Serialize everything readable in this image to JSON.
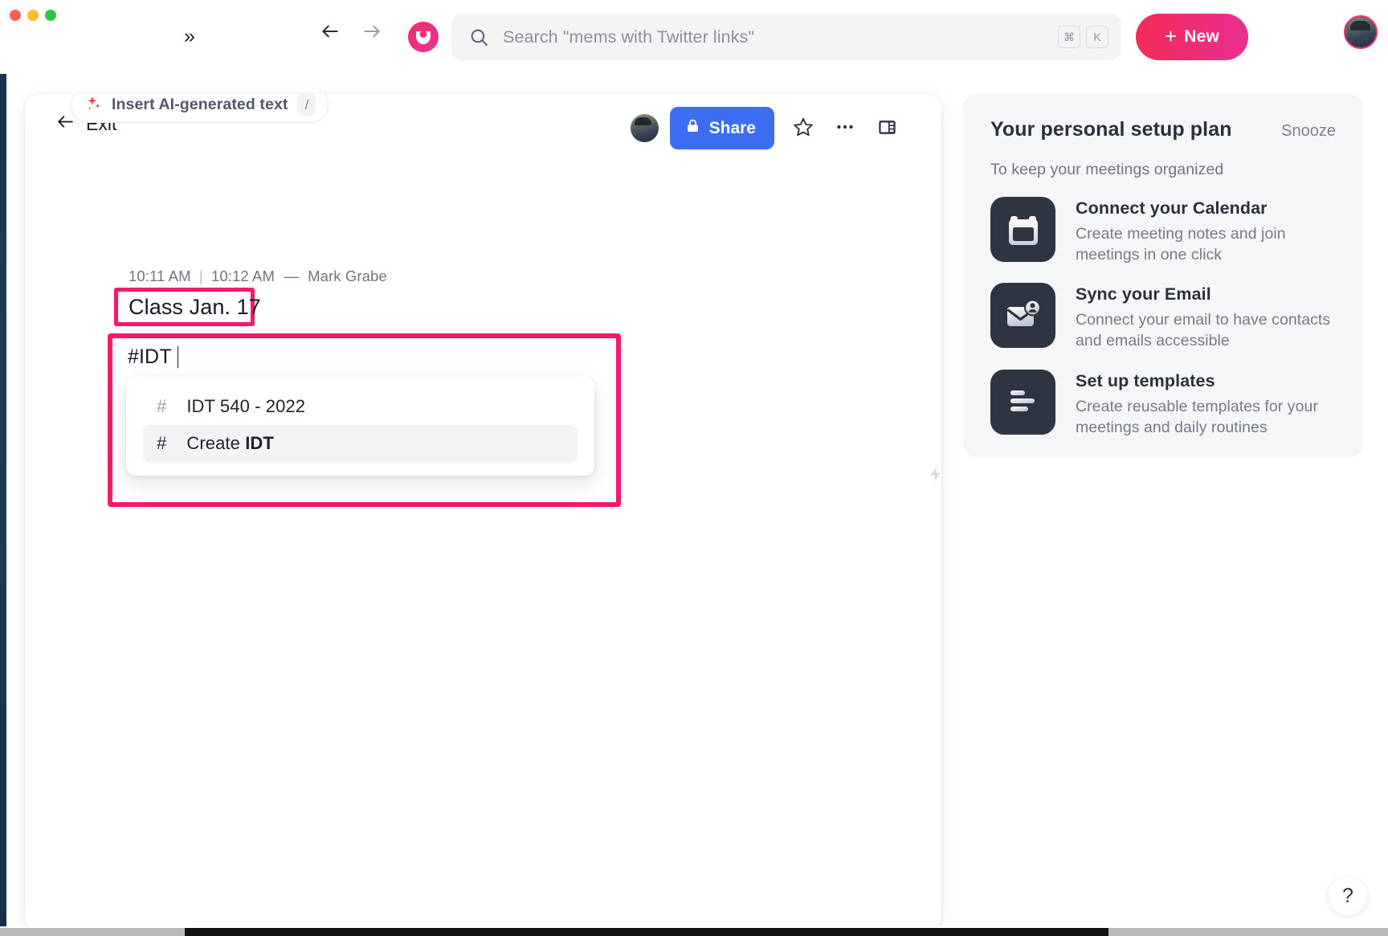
{
  "window": {
    "traffic_lights": [
      "close",
      "minimize",
      "maximize"
    ],
    "expand_label": "»"
  },
  "topbar": {
    "back_icon": "arrow-left-icon",
    "forward_icon": "arrow-right-icon",
    "logo_name": "mem-logo",
    "search": {
      "icon": "search-icon",
      "placeholder": "Search \"mems with Twitter links\"",
      "value": "",
      "shortcut_keys": [
        "⌘",
        "K"
      ]
    },
    "new_button": {
      "label": "New",
      "plus": "+"
    },
    "avatar_name": "user-avatar"
  },
  "document": {
    "toolbar": {
      "exit_label": "Exit",
      "share_label": "Share",
      "share_lock_icon": "lock-icon",
      "star_icon": "star-icon",
      "more_icon": "ellipsis-icon",
      "panel_toggle_icon": "side-panel-icon",
      "collaborator_avatar": "collaborator-avatar"
    },
    "meta": {
      "created_time": "10:11 AM",
      "separator": "|",
      "updated_time": "10:12 AM",
      "dash": "—",
      "author": "Mark Grabe"
    },
    "title": "Class Jan. 17",
    "composer": {
      "value": "#IDT",
      "bolt_icon": "lightning-bolt-icon"
    },
    "mention_menu": {
      "items": [
        {
          "hash": "#",
          "label": "IDT 540 - 2022",
          "bold_part": "",
          "selected": false
        },
        {
          "hash": "#",
          "label": "Create ",
          "bold_part": "IDT",
          "selected": true
        }
      ]
    },
    "ai_button": {
      "sparkle_icon": "sparkle-icon",
      "label": "Insert AI-generated text",
      "shortcut": "/"
    }
  },
  "side_panel": {
    "title": "Your personal setup plan",
    "snooze_label": "Snooze",
    "subtitle": "To keep your meetings organized",
    "items": [
      {
        "icon": "calendar-icon",
        "title": "Connect your Calendar",
        "description": "Create meeting notes and join meetings in one click"
      },
      {
        "icon": "email-contact-icon",
        "title": "Sync your Email",
        "description": "Connect your email to have contacts and emails accessible"
      },
      {
        "icon": "template-lines-icon",
        "title": "Set up templates",
        "description": "Create reusable templates for your meetings and daily routines"
      }
    ]
  },
  "help": {
    "label": "?"
  },
  "colors": {
    "brand_pink": "#ec2d7c",
    "highlight_pink": "#f5186b",
    "share_blue": "#3b6ef0",
    "panel_bg": "#f5f6f8",
    "icon_dark": "#2e3442"
  }
}
